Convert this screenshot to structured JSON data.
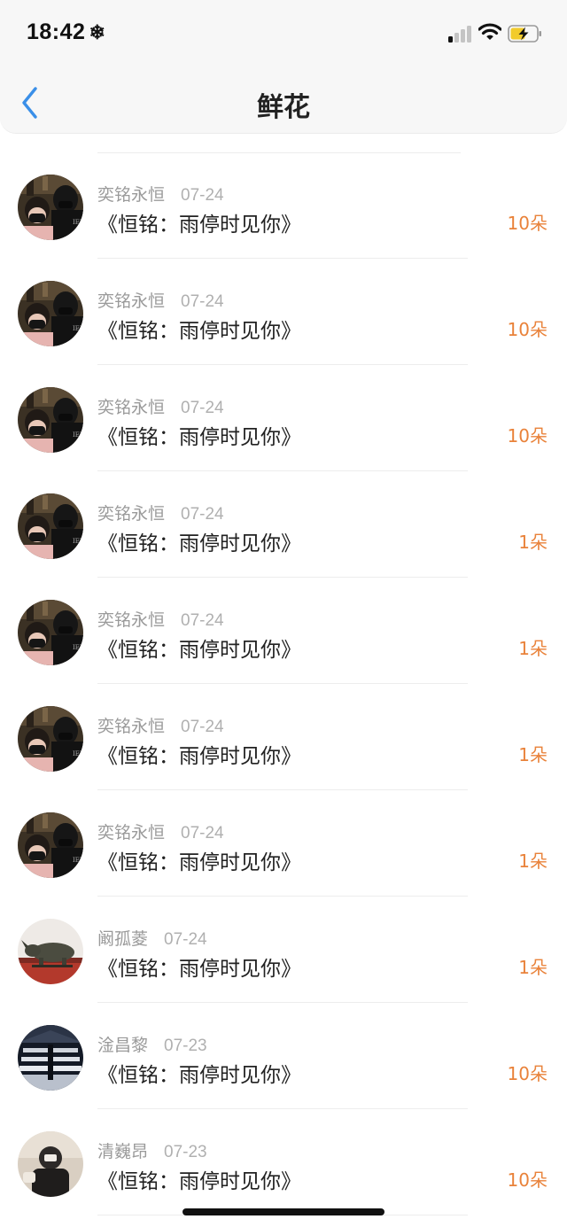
{
  "status_bar": {
    "time": "18:42",
    "extra_icon": "snowflake-icon"
  },
  "nav": {
    "title": "鲜花",
    "back_icon": "chevron-left-icon"
  },
  "colors": {
    "accent": "#e9823a",
    "back": "#3a8fe8",
    "muted": "#9a9a9a"
  },
  "rows": [
    {
      "name": "奕铭永恒",
      "date": "07-24",
      "work": "《恒铭：雨停时见你》",
      "count": "10朵",
      "avatar": "couple"
    },
    {
      "name": "奕铭永恒",
      "date": "07-24",
      "work": "《恒铭：雨停时见你》",
      "count": "10朵",
      "avatar": "couple"
    },
    {
      "name": "奕铭永恒",
      "date": "07-24",
      "work": "《恒铭：雨停时见你》",
      "count": "10朵",
      "avatar": "couple"
    },
    {
      "name": "奕铭永恒",
      "date": "07-24",
      "work": "《恒铭：雨停时见你》",
      "count": "1朵",
      "avatar": "couple"
    },
    {
      "name": "奕铭永恒",
      "date": "07-24",
      "work": "《恒铭：雨停时见你》",
      "count": "1朵",
      "avatar": "couple"
    },
    {
      "name": "奕铭永恒",
      "date": "07-24",
      "work": "《恒铭：雨停时见你》",
      "count": "1朵",
      "avatar": "couple"
    },
    {
      "name": "奕铭永恒",
      "date": "07-24",
      "work": "《恒铭：雨停时见你》",
      "count": "1朵",
      "avatar": "couple"
    },
    {
      "name": "阚孤菱",
      "date": "07-24",
      "work": "《恒铭：雨停时见你》",
      "count": "1朵",
      "avatar": "rhino"
    },
    {
      "name": "淦昌黎",
      "date": "07-23",
      "work": "《恒铭：雨停时见你》",
      "count": "10朵",
      "avatar": "stadium"
    },
    {
      "name": "清巍昂",
      "date": "07-23",
      "work": "《恒铭：雨停时见你》",
      "count": "10朵",
      "avatar": "figure"
    }
  ]
}
